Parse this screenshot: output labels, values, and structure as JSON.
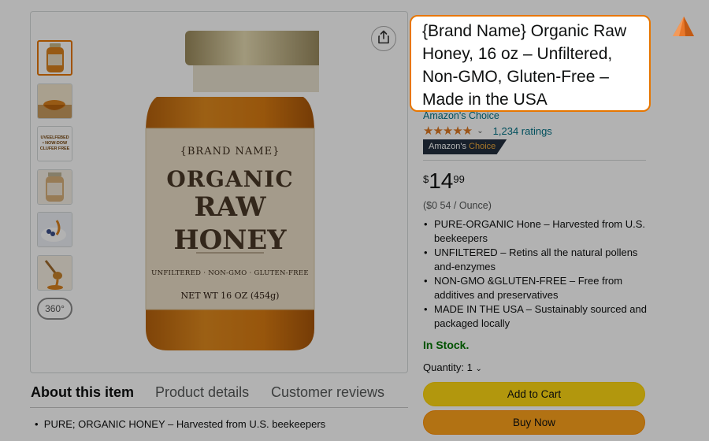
{
  "gallery": {
    "thumb_text": [
      "UVEELFEBED",
      "• NOW-DOW",
      "CLUFER FREE"
    ],
    "thumb_360_label": "360°"
  },
  "jar": {
    "brand": "{BRAND NAME}",
    "line1": "ORGANIC",
    "line2": "RAW",
    "line3": "HONEY",
    "sub": "UNFILTERED · NON-GMO · GLUTEN-FREE",
    "net": "NET WT 16 OZ (454g)"
  },
  "tabs": [
    {
      "label": "About this item",
      "active": true
    },
    {
      "label": "Product details",
      "active": false
    },
    {
      "label": "Customer reviews",
      "active": false
    }
  ],
  "about": {
    "first_bullet": "PURE; ORGANIC HONEY – Harvested from U.S. beekeepers"
  },
  "product": {
    "title": "{Brand Name} Organic Raw Honey, 16 oz – Unfiltered, Non-GMO, Gluten-Free – Made in the USA",
    "choice_link": "Amazon's Choice",
    "stars": "★★★★★",
    "rating_count": "1,234 ratings",
    "badge_prefix": "Amazon's",
    "badge_highlight": "Choice",
    "price_symbol": "$",
    "price_whole": "14",
    "price_fraction": "99",
    "unit_price": "($0 54 / Ounce)",
    "bullets": [
      "PURE-ORGANIC Hone – Harvested from U.S. beekeepers",
      "UNFILTERED – Retins all the natural pollens and-enzymes",
      "NON-GMO &GLUTEN-FREE – Free from additives and preservatives",
      "MADE IN THE USA – Sustainably sourced and packaged locally"
    ],
    "stock": "In Stock.",
    "quantity_label": "Quantity: 1",
    "add_to_cart": "Add to Cart",
    "buy_now": "Buy Now"
  },
  "colors": {
    "accent_orange": "#e77600",
    "link": "#007185",
    "stock_green": "#007600",
    "cart_yellow": "#FFD814",
    "buy_orange": "#FFA41C"
  }
}
